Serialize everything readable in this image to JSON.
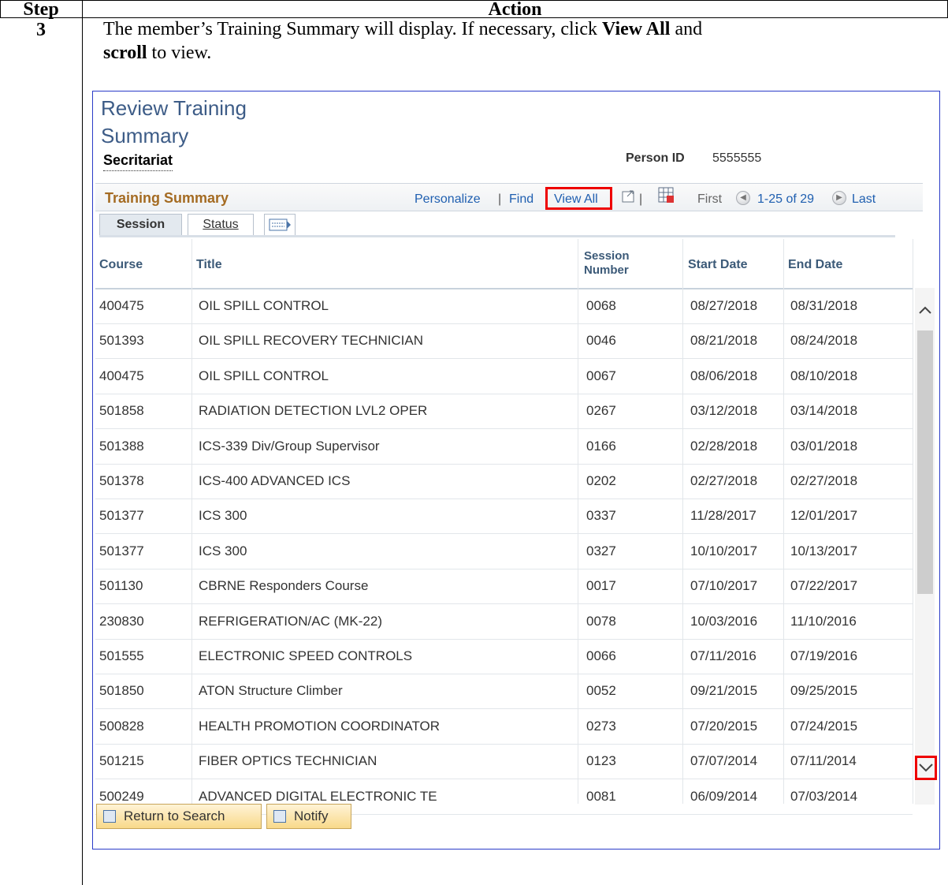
{
  "doc": {
    "header_step": "Step",
    "header_action": "Action",
    "step_number": "3",
    "instruction_part1": "The member’s Training Summary will display.  If necessary, click ",
    "instruction_bold1": "View All",
    "instruction_part2": " and ",
    "instruction_bold2": "scroll",
    "instruction_part3": " to view."
  },
  "page": {
    "title_line1": "Review Training",
    "title_line2": "Summary",
    "person_name": "Secritariat",
    "person_id_label": "Person ID",
    "person_id": "5555555"
  },
  "grid": {
    "title": "Training Summary",
    "personalize": "Personalize",
    "find": "Find",
    "view_all": "View All",
    "sep": "|",
    "first": "First",
    "range": "1-25 of 29",
    "last": "Last",
    "tabs": {
      "session": "Session",
      "status": "Status"
    },
    "columns": {
      "course": "Course",
      "title": "Title",
      "session_number_1": "Session",
      "session_number_2": "Number",
      "start_date": "Start Date",
      "end_date": "End Date"
    },
    "rows": [
      {
        "course": "400475",
        "title": "OIL SPILL CONTROL",
        "session": "0068",
        "start": "08/27/2018",
        "end": "08/31/2018"
      },
      {
        "course": "501393",
        "title": "OIL SPILL RECOVERY TECHNICIAN",
        "session": "0046",
        "start": "08/21/2018",
        "end": "08/24/2018"
      },
      {
        "course": "400475",
        "title": "OIL SPILL CONTROL",
        "session": "0067",
        "start": "08/06/2018",
        "end": "08/10/2018"
      },
      {
        "course": "501858",
        "title": "RADIATION DETECTION LVL2 OPER",
        "session": "0267",
        "start": "03/12/2018",
        "end": "03/14/2018"
      },
      {
        "course": "501388",
        "title": "ICS-339 Div/Group Supervisor",
        "session": "0166",
        "start": "02/28/2018",
        "end": "03/01/2018"
      },
      {
        "course": "501378",
        "title": "ICS-400 ADVANCED ICS",
        "session": "0202",
        "start": "02/27/2018",
        "end": "02/27/2018"
      },
      {
        "course": "501377",
        "title": "ICS 300",
        "session": "0337",
        "start": "11/28/2017",
        "end": "12/01/2017"
      },
      {
        "course": "501377",
        "title": "ICS 300",
        "session": "0327",
        "start": "10/10/2017",
        "end": "10/13/2017"
      },
      {
        "course": "501130",
        "title": "CBRNE Responders Course",
        "session": "0017",
        "start": "07/10/2017",
        "end": "07/22/2017"
      },
      {
        "course": "230830",
        "title": "REFRIGERATION/AC (MK-22)",
        "session": "0078",
        "start": "10/03/2016",
        "end": "11/10/2016"
      },
      {
        "course": "501555",
        "title": "ELECTRONIC SPEED CONTROLS",
        "session": "0066",
        "start": "07/11/2016",
        "end": "07/19/2016"
      },
      {
        "course": "501850",
        "title": "ATON Structure Climber",
        "session": "0052",
        "start": "09/21/2015",
        "end": "09/25/2015"
      },
      {
        "course": "500828",
        "title": "HEALTH PROMOTION COORDINATOR",
        "session": "0273",
        "start": "07/20/2015",
        "end": "07/24/2015"
      },
      {
        "course": "501215",
        "title": "FIBER OPTICS TECHNICIAN",
        "session": "0123",
        "start": "07/07/2014",
        "end": "07/11/2014"
      },
      {
        "course": "500249",
        "title": "ADVANCED DIGITAL ELECTRONIC TE",
        "session": "0081",
        "start": "06/09/2014",
        "end": "07/03/2014"
      }
    ]
  },
  "buttons": {
    "return_to_search": "Return to Search",
    "notify": "Notify"
  },
  "colors": {
    "accent_red": "#e00000",
    "grid_title": "#a46b22",
    "link_blue": "#1f5fb0",
    "page_title": "#3d5c87"
  },
  "icons": [
    "popup-icon",
    "download-icon",
    "previous-icon",
    "next-icon",
    "show-all-columns-icon",
    "scroll-up-icon",
    "scroll-down-icon",
    "search-icon",
    "notify-icon"
  ]
}
